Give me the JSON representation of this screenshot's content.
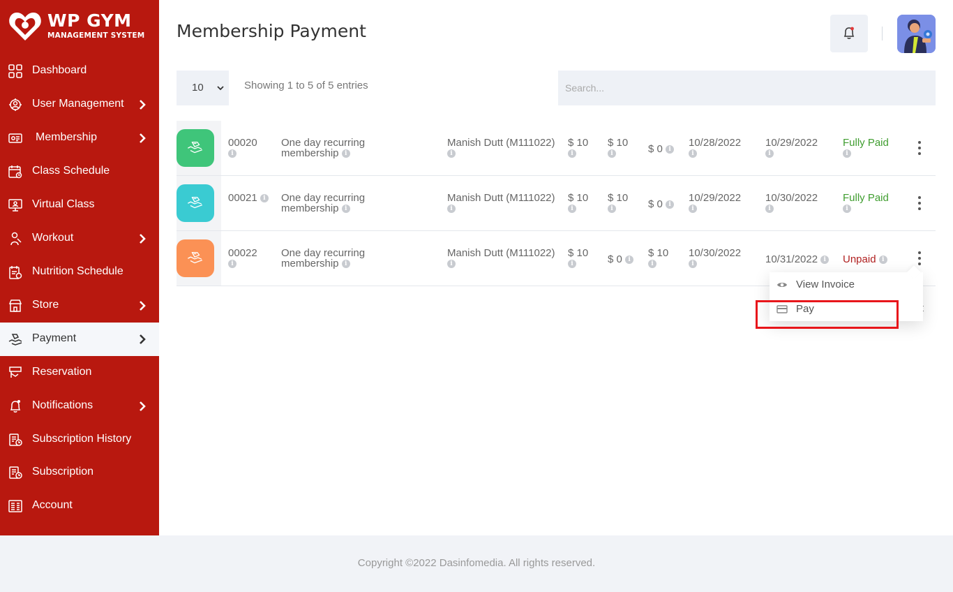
{
  "brand": {
    "title": "WP GYM",
    "subtitle": "MANAGEMENT SYSTEM"
  },
  "sidebar": {
    "items": [
      {
        "label": "Dashboard",
        "icon": "dashboard-grid-icon",
        "has_submenu": false
      },
      {
        "label": "User Management",
        "icon": "users-gear-icon",
        "has_submenu": true
      },
      {
        "label": "Membership",
        "icon": "id-card-icon",
        "has_submenu": true
      },
      {
        "label": "Class Schedule",
        "icon": "calendar-icon",
        "has_submenu": false
      },
      {
        "label": "Virtual Class",
        "icon": "virtual-class-icon",
        "has_submenu": false
      },
      {
        "label": "Workout",
        "icon": "workout-icon",
        "has_submenu": true
      },
      {
        "label": "Nutrition Schedule",
        "icon": "nutrition-icon",
        "has_submenu": false
      },
      {
        "label": "Store",
        "icon": "store-icon",
        "has_submenu": true
      },
      {
        "label": "Payment",
        "icon": "payment-hand-icon",
        "has_submenu": true,
        "active": true
      },
      {
        "label": "Reservation",
        "icon": "reservation-icon",
        "has_submenu": false
      },
      {
        "label": "Notifications",
        "icon": "bell-icon",
        "has_submenu": true
      },
      {
        "label": "Subscription History",
        "icon": "subscription-history-icon",
        "has_submenu": false
      },
      {
        "label": "Subscription",
        "icon": "subscription-icon",
        "has_submenu": false
      },
      {
        "label": "Account",
        "icon": "account-icon",
        "has_submenu": false
      }
    ]
  },
  "header": {
    "title": "Membership Payment"
  },
  "table": {
    "page_length": "10",
    "info": "Showing 1 to 5 of 5 entries",
    "search_placeholder": "Search...",
    "rows": [
      {
        "icon_color": "#3fc57a",
        "id": "00020",
        "membership_line1": "One day recurring",
        "membership_line2": "membership",
        "member": "Manish Dutt (M111022)",
        "amount": "$ 10",
        "paid": "$ 10",
        "due": "$ 0",
        "start_date": "10/28/2022",
        "end_date": "10/29/2022",
        "status": "Fully Paid"
      },
      {
        "icon_color": "#3acbd2",
        "id": "00021",
        "membership_line1": "One day recurring",
        "membership_line2": "membership",
        "member": "Manish Dutt (M111022)",
        "amount": "$ 10",
        "paid": "$ 10",
        "due": "$ 0",
        "start_date": "10/29/2022",
        "end_date": "10/30/2022",
        "status": "Fully Paid"
      },
      {
        "icon_color": "#fb9155",
        "id": "00022",
        "membership_line1": "One day recurring",
        "membership_line2": "membership",
        "member": "Manish Dutt (M111022)",
        "amount": "$ 10",
        "paid": "$ 0",
        "due": "$ 10",
        "start_date": "10/30/2022",
        "end_date": "10/31/2022",
        "status": "Unpaid"
      }
    ]
  },
  "dropdown": {
    "items": [
      {
        "label": "View Invoice",
        "icon": "eye-icon"
      },
      {
        "label": "Pay",
        "icon": "credit-card-icon"
      }
    ]
  },
  "stray_text": "t",
  "footer": {
    "copyright": "Copyright ©2022 Dasinfomedia. All rights reserved."
  },
  "colors": {
    "sidebar_bg": "#b8180f",
    "paid": "#3f9d2f",
    "unpaid": "#b02020",
    "highlight": "#e8161b"
  }
}
